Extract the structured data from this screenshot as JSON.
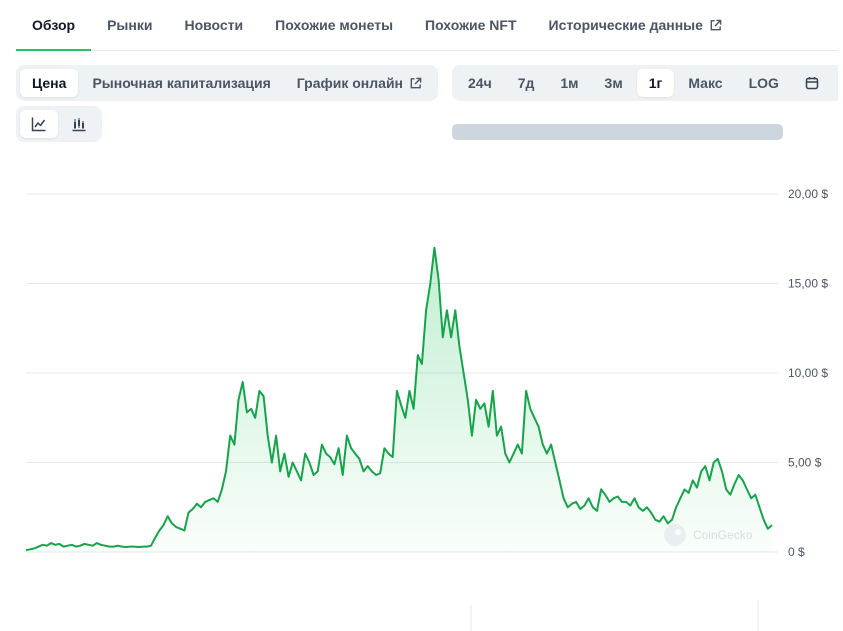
{
  "tabs": [
    {
      "label": "Обзор",
      "active": true
    },
    {
      "label": "Рынки"
    },
    {
      "label": "Новости"
    },
    {
      "label": "Похожие монеты"
    },
    {
      "label": "Похожие NFT"
    },
    {
      "label": "Исторические данные",
      "external": true
    }
  ],
  "metric_tabs": [
    {
      "label": "Цена",
      "active": true
    },
    {
      "label": "Рыночная капитализация"
    },
    {
      "label": "График онлайн",
      "external": true
    }
  ],
  "range_tabs": [
    {
      "label": "24ч"
    },
    {
      "label": "7д"
    },
    {
      "label": "1м"
    },
    {
      "label": "3м"
    },
    {
      "label": "1г",
      "active": true
    },
    {
      "label": "Макс"
    },
    {
      "label": "LOG"
    }
  ],
  "chart_type_buttons": [
    {
      "icon": "line-chart-icon",
      "active": true
    },
    {
      "icon": "candlestick-chart-icon"
    }
  ],
  "extra_icons": [
    "calendar-icon",
    "expand-icon"
  ],
  "colors": {
    "accent": "#16a34a",
    "fill": "#22c55e",
    "grid": "#e5e7eb",
    "tab_underline": "#22c55e"
  },
  "watermark": "CoinGecko",
  "chart_data": {
    "type": "area",
    "y_tick_labels": [
      "20,00 $",
      "15,00 $",
      "10,00 $",
      "5,00 $",
      "0 $"
    ],
    "y_ticks": [
      20,
      15,
      10,
      5,
      0
    ],
    "ylim": [
      0,
      20
    ],
    "grid": true,
    "values": [
      0.1,
      0.15,
      0.2,
      0.3,
      0.4,
      0.35,
      0.5,
      0.4,
      0.45,
      0.3,
      0.35,
      0.4,
      0.3,
      0.35,
      0.45,
      0.4,
      0.35,
      0.5,
      0.4,
      0.35,
      0.3,
      0.3,
      0.35,
      0.3,
      0.28,
      0.3,
      0.3,
      0.28,
      0.3,
      0.3,
      0.35,
      0.8,
      1.2,
      1.5,
      2.0,
      1.6,
      1.4,
      1.3,
      1.2,
      2.2,
      2.4,
      2.7,
      2.5,
      2.8,
      2.9,
      3.0,
      2.8,
      3.5,
      4.5,
      6.5,
      6.0,
      8.5,
      9.5,
      7.8,
      8.0,
      7.5,
      9.0,
      8.7,
      6.5,
      5.0,
      6.5,
      4.5,
      5.5,
      4.2,
      5.0,
      4.5,
      4.0,
      5.5,
      5.0,
      4.3,
      4.5,
      6.0,
      5.5,
      5.3,
      4.9,
      5.8,
      4.3,
      6.5,
      5.8,
      5.5,
      5.2,
      4.5,
      4.8,
      4.5,
      4.3,
      4.4,
      5.8,
      5.5,
      5.3,
      9.0,
      8.2,
      7.5,
      9.0,
      8.0,
      11.0,
      10.5,
      13.5,
      15.0,
      17.0,
      15.2,
      12.0,
      13.5,
      12.0,
      13.5,
      11.5,
      10.0,
      8.5,
      6.5,
      8.5,
      8.0,
      8.3,
      7.0,
      9.0,
      6.5,
      7.0,
      5.5,
      5.0,
      5.5,
      6.0,
      5.5,
      9.0,
      8.0,
      7.5,
      7.0,
      6.0,
      5.5,
      6.0,
      5.0,
      4.0,
      3.0,
      2.5,
      2.7,
      2.8,
      2.4,
      2.6,
      3.0,
      2.5,
      2.3,
      3.5,
      3.2,
      2.8,
      3.0,
      3.1,
      2.8,
      2.8,
      2.6,
      3.0,
      2.5,
      2.3,
      2.5,
      2.2,
      1.8,
      1.7,
      2.0,
      1.6,
      1.8,
      2.5,
      3.0,
      3.5,
      3.3,
      4.0,
      3.6,
      4.5,
      4.8,
      4.0,
      5.0,
      5.2,
      4.5,
      3.5,
      3.2,
      3.8,
      4.3,
      4.0,
      3.5,
      3.0,
      3.2,
      2.5,
      1.8,
      1.3,
      1.5
    ]
  }
}
